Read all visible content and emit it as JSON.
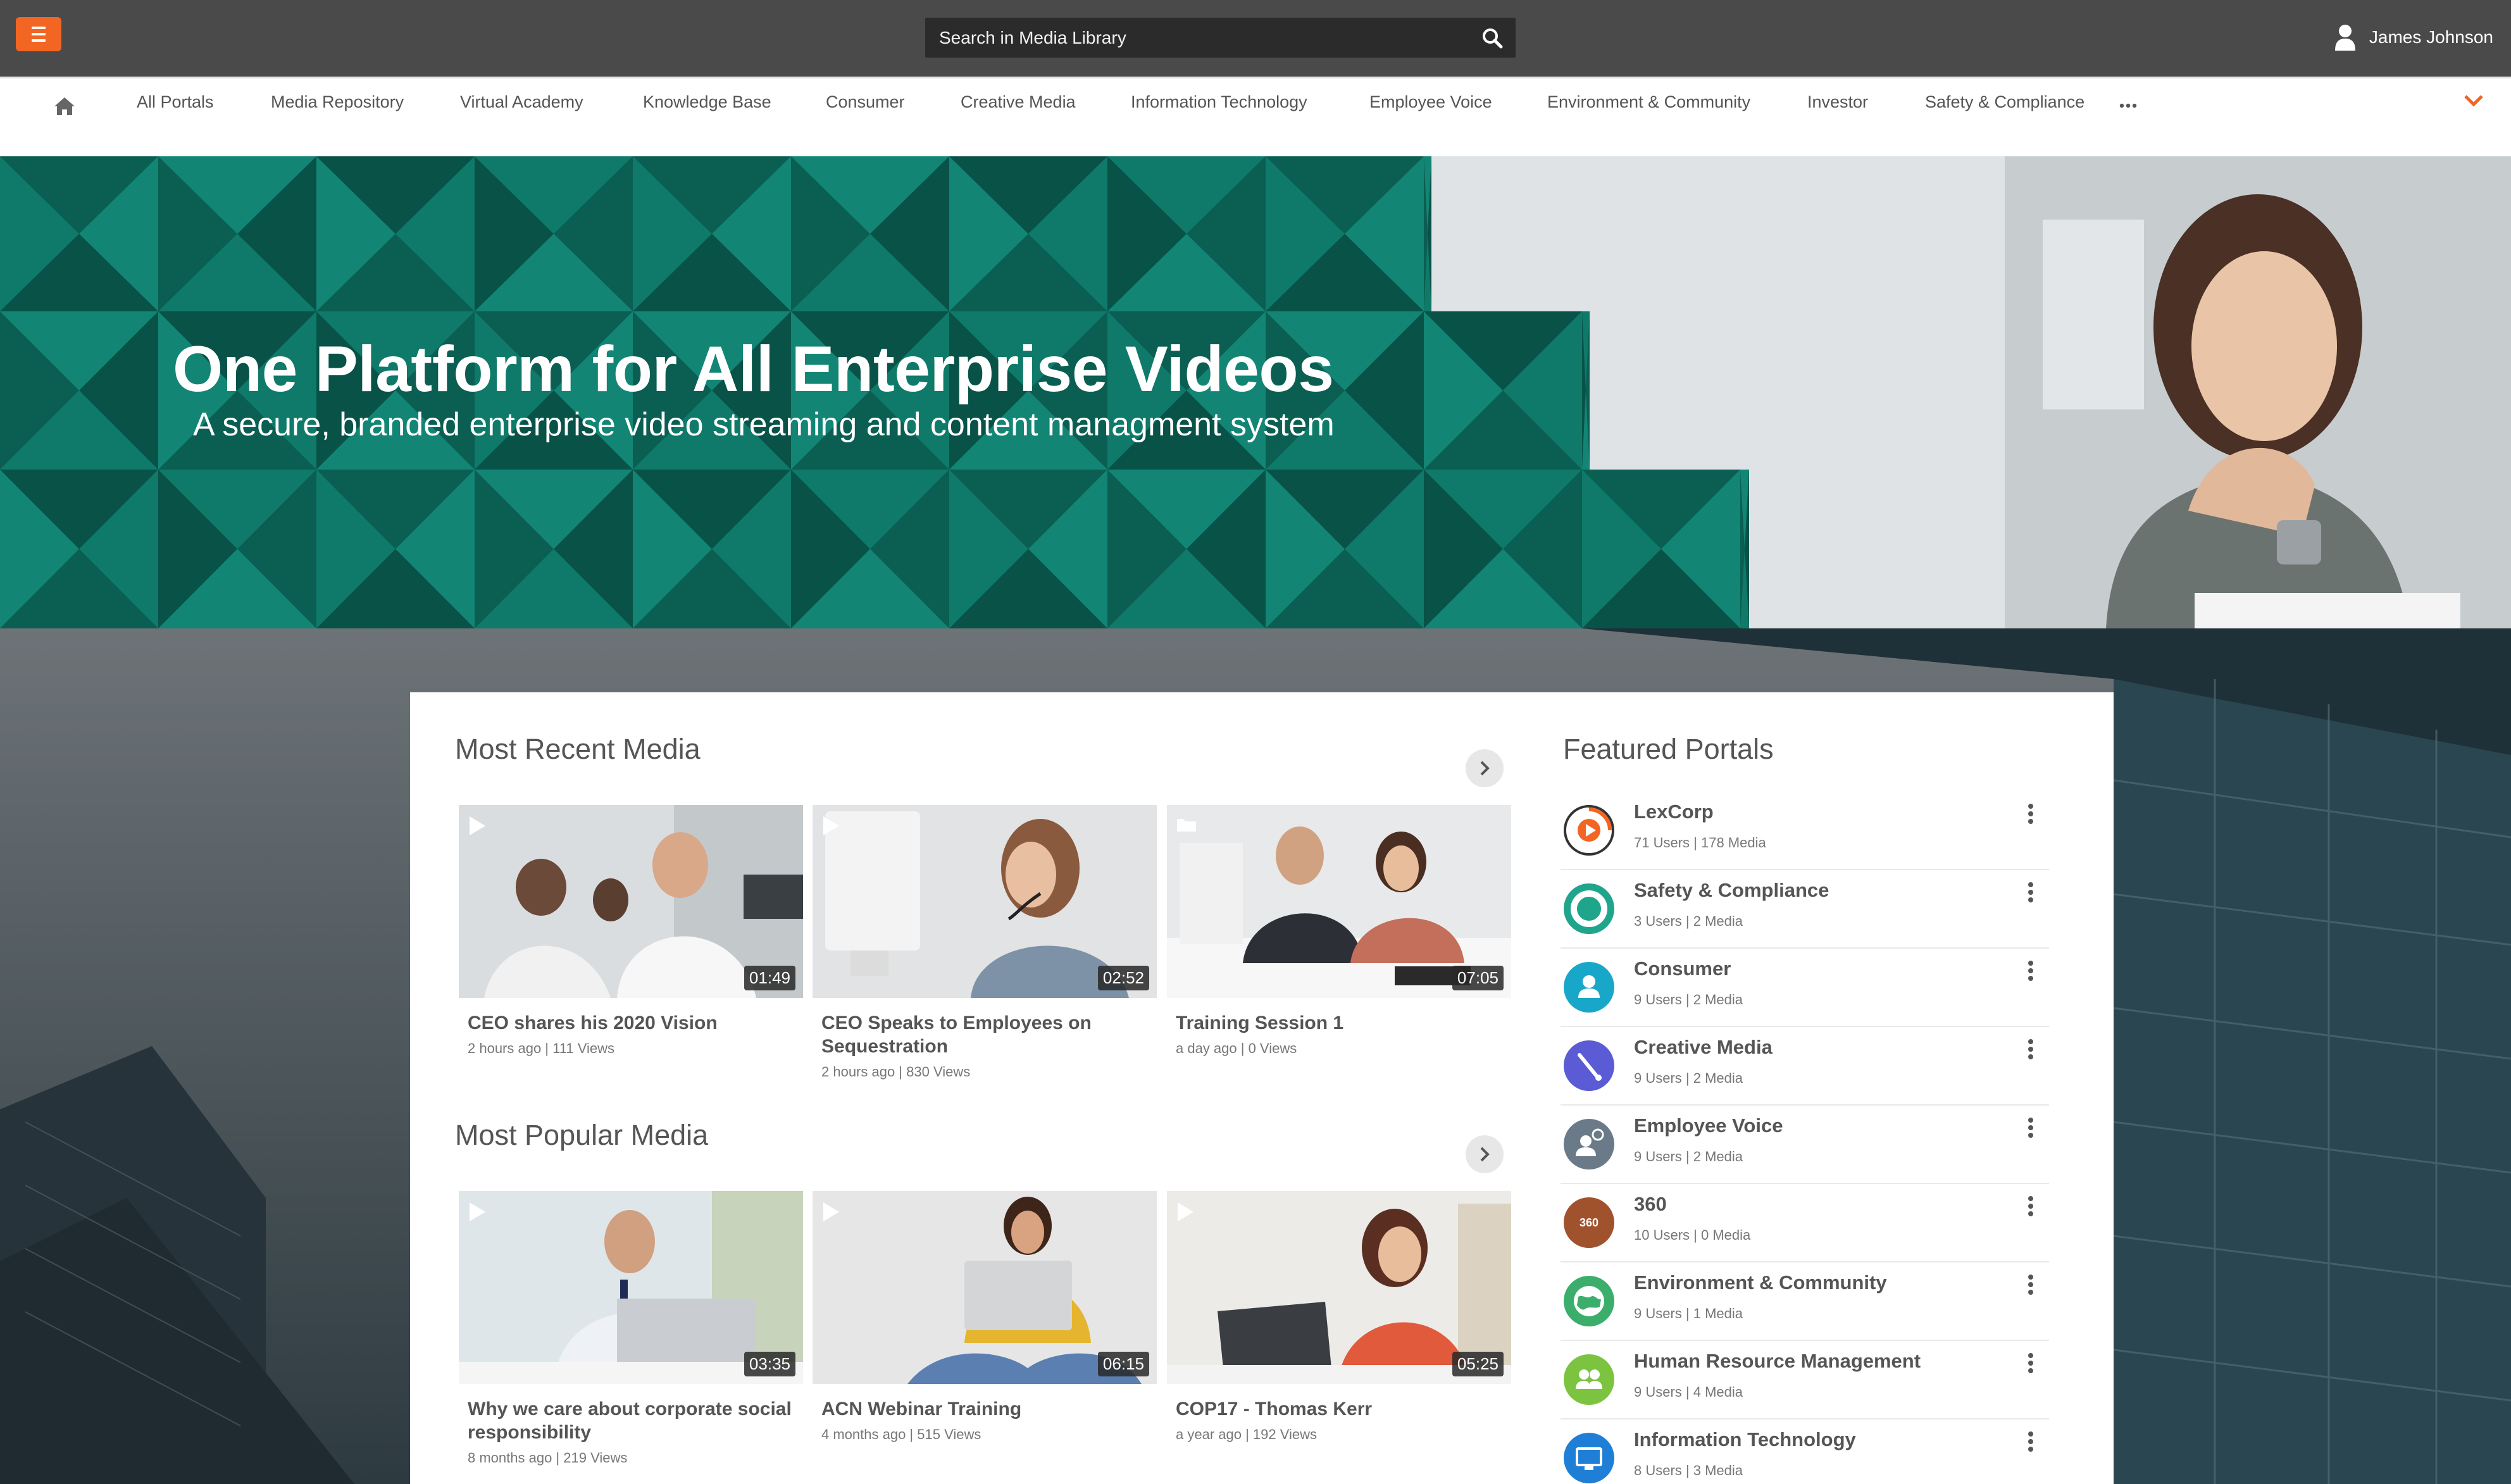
{
  "header": {
    "search_placeholder": "Search in Media Library",
    "user_name": "James Johnson",
    "accent_color": "#f26522"
  },
  "nav": {
    "items": [
      {
        "label": "All Portals"
      },
      {
        "label": "Media Repository"
      },
      {
        "label": "Virtual Academy"
      },
      {
        "label": "Knowledge Base"
      },
      {
        "label": "Consumer"
      },
      {
        "label": "Creative Media"
      },
      {
        "label": "Information Technology"
      },
      {
        "label": "Employee Voice"
      },
      {
        "label": "Environment & Community"
      },
      {
        "label": "Investor"
      },
      {
        "label": "Safety & Compliance"
      }
    ]
  },
  "hero": {
    "title": "One Platform for All Enterprise Videos",
    "subtitle": "A secure, branded enterprise video streaming and content managment system",
    "pattern_color": "#0b6b5c"
  },
  "recent": {
    "title": "Most Recent Media",
    "items": [
      {
        "title": "CEO shares his 2020 Vision",
        "meta": "2 hours ago | 111 Views",
        "duration": "01:49",
        "icon": "play-icon"
      },
      {
        "title": "CEO Speaks to Employees on Sequestration",
        "meta": "2 hours ago | 830 Views",
        "duration": "02:52",
        "icon": "play-icon"
      },
      {
        "title": "Training Session 1",
        "meta": "a day ago | 0 Views",
        "duration": "07:05",
        "icon": "folder-icon"
      }
    ]
  },
  "popular": {
    "title": "Most Popular Media",
    "items": [
      {
        "title": "Why we care about corporate social responsibility",
        "meta": "8 months ago | 219 Views",
        "duration": "03:35",
        "icon": "play-icon"
      },
      {
        "title": "ACN Webinar Training",
        "meta": "4 months ago | 515 Views",
        "duration": "06:15",
        "icon": "play-icon"
      },
      {
        "title": "COP17 - Thomas Kerr",
        "meta": "a year ago | 192 Views",
        "duration": "05:25",
        "icon": "play-icon"
      }
    ]
  },
  "featured": {
    "title": "Featured Portals",
    "items": [
      {
        "name": "LexCorp",
        "meta": "71 Users | 178 Media",
        "icon": "lexcorp-logo-icon",
        "color": "#f26522"
      },
      {
        "name": "Safety & Compliance",
        "meta": "3 Users | 2 Media",
        "icon": "lifebuoy-icon",
        "color": "#1fa58c"
      },
      {
        "name": "Consumer",
        "meta": "9 Users | 2 Media",
        "icon": "user-icon",
        "color": "#19a7c9"
      },
      {
        "name": "Creative Media",
        "meta": "9 Users | 2 Media",
        "icon": "brush-icon",
        "color": "#5b5bd6"
      },
      {
        "name": "Employee Voice",
        "meta": "9 Users | 2 Media",
        "icon": "speaker-user-icon",
        "color": "#6a7a88"
      },
      {
        "name": "360",
        "meta": "10 Users | 0 Media",
        "icon": "360-icon",
        "badge": "360",
        "color": "#a0522d"
      },
      {
        "name": "Environment & Community",
        "meta": "9 Users | 1 Media",
        "icon": "globe-icon",
        "color": "#3cae6b"
      },
      {
        "name": "Human Resource Management",
        "meta": "9 Users | 4 Media",
        "icon": "users-icon",
        "color": "#7cc440"
      },
      {
        "name": "Information Technology",
        "meta": "8 Users | 3 Media",
        "icon": "monitor-icon",
        "color": "#1f7fd6"
      }
    ]
  }
}
